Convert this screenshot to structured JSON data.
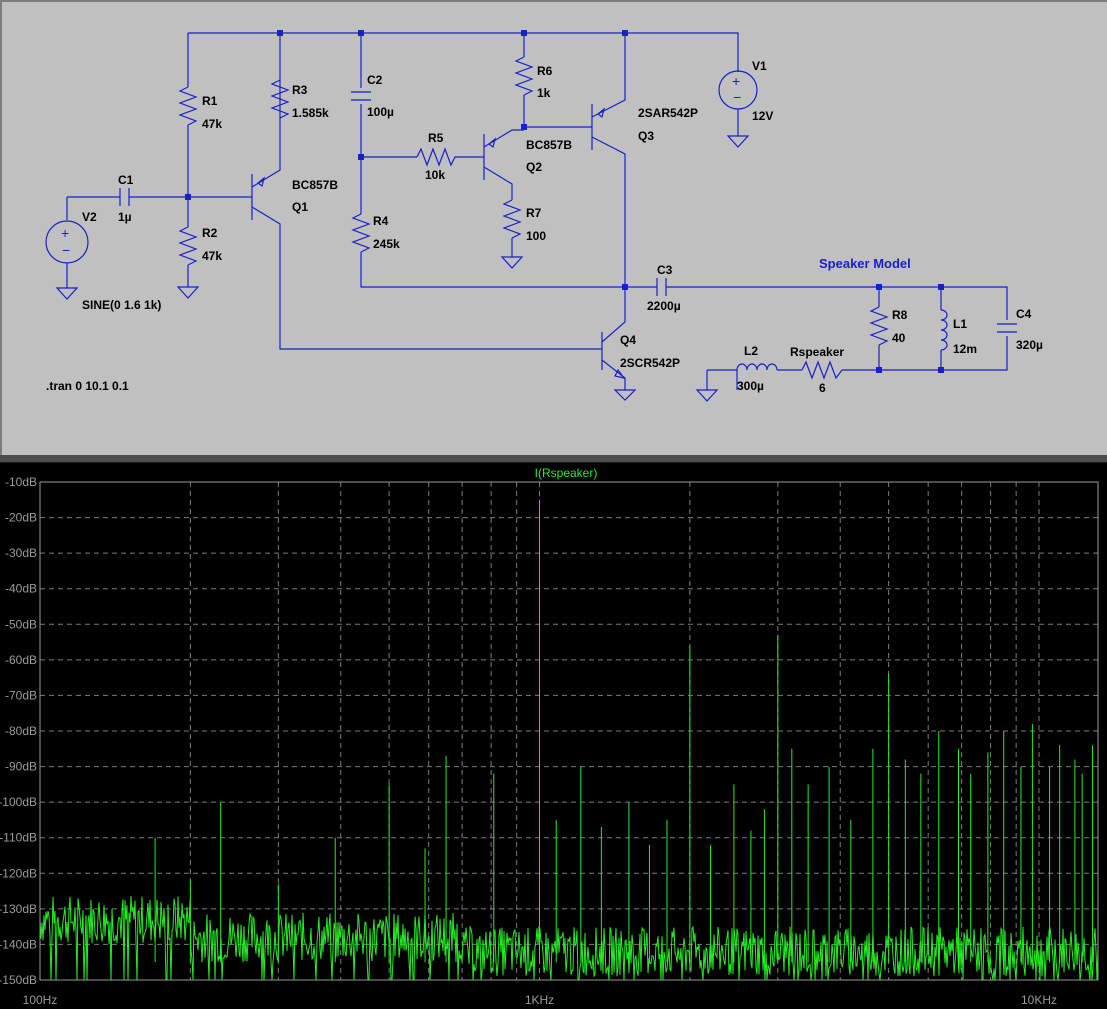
{
  "schematic": {
    "components": [
      {
        "ref": "R1",
        "value": "47k"
      },
      {
        "ref": "R2",
        "value": "47k"
      },
      {
        "ref": "R3",
        "value": "1.585k"
      },
      {
        "ref": "R4",
        "value": "245k"
      },
      {
        "ref": "R5",
        "value": "10k"
      },
      {
        "ref": "R6",
        "value": "1k"
      },
      {
        "ref": "R7",
        "value": "100"
      },
      {
        "ref": "R8",
        "value": "40"
      },
      {
        "ref": "C1",
        "value": "1µ"
      },
      {
        "ref": "C2",
        "value": "100µ"
      },
      {
        "ref": "C3",
        "value": "2200µ"
      },
      {
        "ref": "C4",
        "value": "320µ"
      },
      {
        "ref": "L1",
        "value": "12m"
      },
      {
        "ref": "L2",
        "value": "300µ"
      },
      {
        "ref": "Rspeaker",
        "value": "6"
      },
      {
        "ref": "V1",
        "value": "12V"
      },
      {
        "ref": "V2",
        "value": "SINE(0 1.6 1k)"
      },
      {
        "ref": "Q1",
        "value": "BC857B"
      },
      {
        "ref": "Q2",
        "value": "BC857B"
      },
      {
        "ref": "Q3",
        "value": "2SAR542P"
      },
      {
        "ref": "Q4",
        "value": "2SCR542P"
      }
    ],
    "speaker_label": "Speaker Model",
    "directive": ".tran 0 10.1 0.1"
  },
  "plot": {
    "trace_color": "#22ee22",
    "grid_color": "#7c7c7c"
  },
  "chart_data": {
    "type": "line",
    "title": "I(Rspeaker)",
    "xlabel": "",
    "ylabel": "",
    "x_scale": "log",
    "xlim": [
      100,
      13000
    ],
    "ylim": [
      -150,
      -10
    ],
    "x_ticks": [
      "100Hz",
      "1KHz",
      "10KHz"
    ],
    "y_ticks": [
      "-10dB",
      "-20dB",
      "-30dB",
      "-40dB",
      "-50dB",
      "-60dB",
      "-70dB",
      "-80dB",
      "-90dB",
      "-100dB",
      "-110dB",
      "-120dB",
      "-130dB",
      "-140dB",
      "-150dB"
    ],
    "grid": true,
    "series": [
      {
        "name": "I(Rspeaker)",
        "noise_floor_db": -140,
        "peaks": [
          {
            "x": 170,
            "y": -110
          },
          {
            "x": 200,
            "y": -122
          },
          {
            "x": 230,
            "y": -100
          },
          {
            "x": 300,
            "y": -123
          },
          {
            "x": 390,
            "y": -110
          },
          {
            "x": 500,
            "y": -95
          },
          {
            "x": 590,
            "y": -113
          },
          {
            "x": 650,
            "y": -87
          },
          {
            "x": 810,
            "y": -92
          },
          {
            "x": 1000,
            "y": -15
          },
          {
            "x": 1080,
            "y": -105
          },
          {
            "x": 1210,
            "y": -90
          },
          {
            "x": 1330,
            "y": -107
          },
          {
            "x": 1510,
            "y": -100
          },
          {
            "x": 1660,
            "y": -112
          },
          {
            "x": 1800,
            "y": -105
          },
          {
            "x": 2000,
            "y": -56
          },
          {
            "x": 2200,
            "y": -112
          },
          {
            "x": 2450,
            "y": -95
          },
          {
            "x": 2650,
            "y": -108
          },
          {
            "x": 2820,
            "y": -102
          },
          {
            "x": 3000,
            "y": -53
          },
          {
            "x": 3200,
            "y": -85
          },
          {
            "x": 3450,
            "y": -95
          },
          {
            "x": 3800,
            "y": -90
          },
          {
            "x": 4200,
            "y": -105
          },
          {
            "x": 4650,
            "y": -85
          },
          {
            "x": 5000,
            "y": -64
          },
          {
            "x": 5400,
            "y": -88
          },
          {
            "x": 5800,
            "y": -92
          },
          {
            "x": 6300,
            "y": -80
          },
          {
            "x": 6900,
            "y": -85
          },
          {
            "x": 7300,
            "y": -92
          },
          {
            "x": 7900,
            "y": -86
          },
          {
            "x": 8500,
            "y": -80
          },
          {
            "x": 9200,
            "y": -90
          },
          {
            "x": 9700,
            "y": -78
          },
          {
            "x": 10500,
            "y": -90
          },
          {
            "x": 11000,
            "y": -84
          },
          {
            "x": 11800,
            "y": -88
          },
          {
            "x": 12200,
            "y": -92
          },
          {
            "x": 12800,
            "y": -84
          }
        ]
      }
    ]
  }
}
